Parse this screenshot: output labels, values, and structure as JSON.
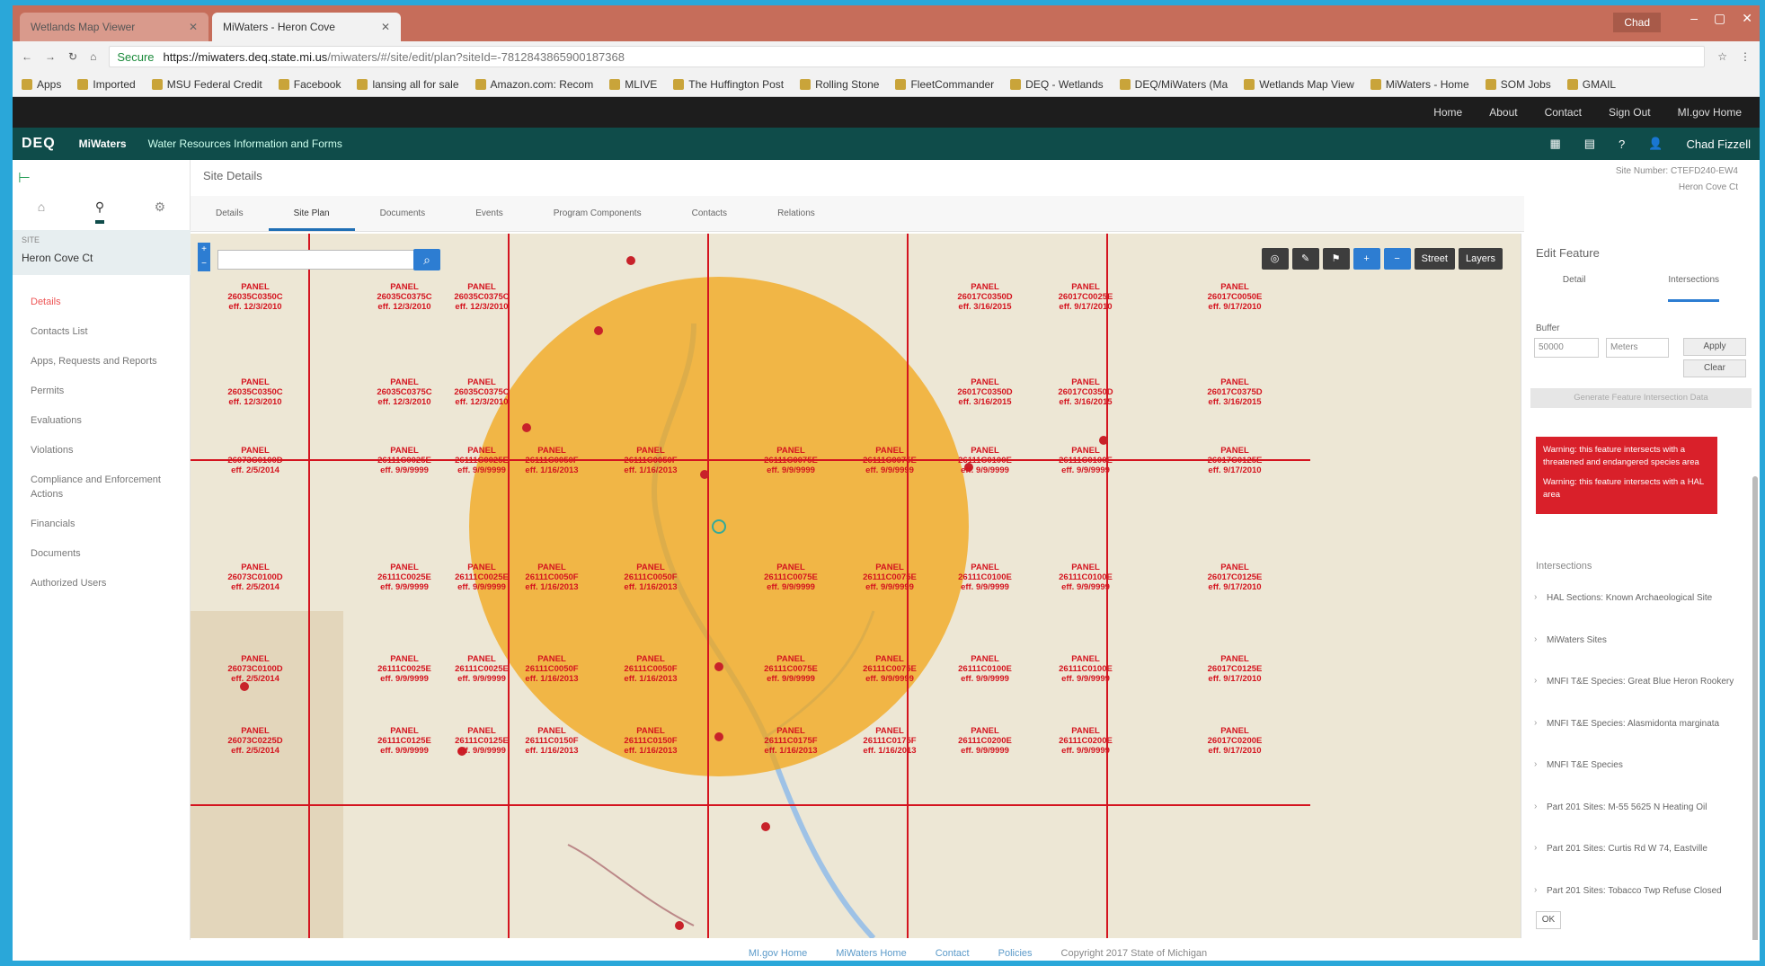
{
  "browser": {
    "tabs": [
      {
        "label": "Wetlands Map Viewer",
        "active": false
      },
      {
        "label": "MiWaters - Heron Cove",
        "active": true
      }
    ],
    "user": "Chad",
    "url": {
      "secure": "Secure",
      "host": "https://miwaters.deq.state.mi.us",
      "path": "/miwaters/#/site/edit/plan?siteId=-7812843865900187368"
    },
    "bookmarks": [
      "Apps",
      "Imported",
      "MSU Federal Credit",
      "Facebook",
      "lansing all for sale",
      "Amazon.com: Recom",
      "MLIVE",
      "The Huffington Post",
      "Rolling Stone",
      "FleetCommander",
      "DEQ - Wetlands",
      "DEQ/MiWaters (Ma",
      "Wetlands Map View",
      "MiWaters - Home",
      "SOM Jobs",
      "GMAIL"
    ]
  },
  "topnav": [
    "Home",
    "About",
    "Contact",
    "Sign Out",
    "MI.gov Home"
  ],
  "appbar": {
    "logo": "DEQ",
    "app": "MiWaters",
    "subtitle": "Water Resources Information and Forms",
    "user": "Chad Fizzell"
  },
  "left": {
    "site_label": "SITE",
    "site_name": "Heron Cove Ct",
    "menu": [
      "Details",
      "Contacts List",
      "Apps, Requests and Reports",
      "Permits",
      "Evaluations",
      "Violations",
      "Compliance and Enforcement Actions",
      "Financials",
      "Documents",
      "Authorized Users"
    ]
  },
  "content": {
    "title": "Site Details",
    "site_number_label": "Site Number: CTEFD240-EW4",
    "site_name": "Heron Cove Ct",
    "tabs": [
      "Details",
      "Site Plan",
      "Documents",
      "Events",
      "Program Components",
      "Contacts",
      "Relations"
    ]
  },
  "map": {
    "tools": [
      "Street",
      "Layers"
    ],
    "panels": [
      [
        "PANEL",
        "26035C0350C",
        "eff. 12/3/2010"
      ],
      [
        "PANEL",
        "26035C0375C",
        "eff. 12/3/2010"
      ],
      [
        "PANEL",
        "26035C0375C",
        "eff. 12/3/2010"
      ],
      [
        "PANEL",
        "26017C0350D",
        "eff. 3/16/2015"
      ],
      [
        "PANEL",
        "26017C0025E",
        "eff. 9/17/2010"
      ],
      [
        "PANEL",
        "26017C0050E",
        "eff. 9/17/2010"
      ],
      [
        "PANEL",
        "26035C0350C",
        "eff. 12/3/2010"
      ],
      [
        "PANEL",
        "26035C0375C",
        "eff. 12/3/2010"
      ],
      [
        "PANEL",
        "26035C0375C",
        "eff. 12/3/2010"
      ],
      [
        "PANEL",
        "26017C0350D",
        "eff. 3/16/2015"
      ],
      [
        "PANEL",
        "26017C0350D",
        "eff. 3/16/2015"
      ],
      [
        "PANEL",
        "26017C0375D",
        "eff. 3/16/2015"
      ],
      [
        "PANEL",
        "26073C0100D",
        "eff. 2/5/2014"
      ],
      [
        "PANEL",
        "26111C0025E",
        "eff. 9/9/9999"
      ],
      [
        "PANEL",
        "26111C0025E",
        "eff. 9/9/9999"
      ],
      [
        "PANEL",
        "26111C0050F",
        "eff. 1/16/2013"
      ],
      [
        "PANEL",
        "26111C0050F",
        "eff. 1/16/2013"
      ],
      [
        "PANEL",
        "26111C0075E",
        "eff. 9/9/9999"
      ],
      [
        "PANEL",
        "26111C0075E",
        "eff. 9/9/9999"
      ],
      [
        "PANEL",
        "26111C0100E",
        "eff. 9/9/9999"
      ],
      [
        "PANEL",
        "26111C0100E",
        "eff. 9/9/9999"
      ],
      [
        "PANEL",
        "26017C0125E",
        "eff. 9/17/2010"
      ],
      [
        "PANEL",
        "26073C0100D",
        "eff. 2/5/2014"
      ],
      [
        "PANEL",
        "26111C0025E",
        "eff. 9/9/9999"
      ],
      [
        "PANEL",
        "26111C0025E",
        "eff. 9/9/9999"
      ],
      [
        "PANEL",
        "26111C0050F",
        "eff. 1/16/2013"
      ],
      [
        "PANEL",
        "26111C0050F",
        "eff. 1/16/2013"
      ],
      [
        "PANEL",
        "26111C0075E",
        "eff. 9/9/9999"
      ],
      [
        "PANEL",
        "26111C0075E",
        "eff. 9/9/9999"
      ],
      [
        "PANEL",
        "26111C0100E",
        "eff. 9/9/9999"
      ],
      [
        "PANEL",
        "26111C0100E",
        "eff. 9/9/9999"
      ],
      [
        "PANEL",
        "26017C0125E",
        "eff. 9/17/2010"
      ],
      [
        "PANEL",
        "26073C0100D",
        "eff. 2/5/2014"
      ],
      [
        "PANEL",
        "26111C0025E",
        "eff. 9/9/9999"
      ],
      [
        "PANEL",
        "26111C0025E",
        "eff. 9/9/9999"
      ],
      [
        "PANEL",
        "26111C0050F",
        "eff. 1/16/2013"
      ],
      [
        "PANEL",
        "26111C0050F",
        "eff. 1/16/2013"
      ],
      [
        "PANEL",
        "26111C0075E",
        "eff. 9/9/9999"
      ],
      [
        "PANEL",
        "26111C0075E",
        "eff. 9/9/9999"
      ],
      [
        "PANEL",
        "26111C0100E",
        "eff. 9/9/9999"
      ],
      [
        "PANEL",
        "26111C0100E",
        "eff. 9/9/9999"
      ],
      [
        "PANEL",
        "26017C0125E",
        "eff. 9/17/2010"
      ],
      [
        "PANEL",
        "26073C0225D",
        "eff. 2/5/2014"
      ],
      [
        "PANEL",
        "26111C0125E",
        "eff. 9/9/9999"
      ],
      [
        "PANEL",
        "26111C0125E",
        "eff. 9/9/9999"
      ],
      [
        "PANEL",
        "26111C0150F",
        "eff. 1/16/2013"
      ],
      [
        "PANEL",
        "26111C0150F",
        "eff. 1/16/2013"
      ],
      [
        "PANEL",
        "26111C0175F",
        "eff. 1/16/2013"
      ],
      [
        "PANEL",
        "26111C0175F",
        "eff. 1/16/2013"
      ],
      [
        "PANEL",
        "26111C0200E",
        "eff. 9/9/9999"
      ],
      [
        "PANEL",
        "26111C0200E",
        "eff. 9/9/9999"
      ],
      [
        "PANEL",
        "26017C0200E",
        "eff. 9/17/2010"
      ]
    ]
  },
  "edit_feature": {
    "title": "Edit Feature",
    "tabs": [
      "Detail",
      "Intersections"
    ],
    "buffer_label": "Buffer",
    "buffer_value": "50000",
    "unit": "Meters",
    "apply": "Apply",
    "clear": "Clear",
    "generate": "Generate Feature Intersection Data",
    "warnings": [
      "Warning: this feature intersects with a threatened and endangered species area",
      "Warning: this feature intersects with a HAL area"
    ],
    "intersections_label": "Intersections",
    "intersections": [
      "HAL Sections: Known Archaeological Site",
      "MiWaters Sites",
      "MNFI T&E Species: Great Blue Heron Rookery",
      "MNFI T&E Species: Alasmidonta marginata",
      "MNFI T&E Species",
      "Part 201 Sites: M-55 5625 N Heating Oil",
      "Part 201 Sites: Curtis Rd W 74, Eastville",
      "Part 201 Sites: Tobacco Twp Refuse Closed"
    ],
    "ok": "OK"
  },
  "footer": [
    "MI.gov Home",
    "MiWaters Home",
    "Contact",
    "Policies",
    "Copyright 2017 State of Michigan"
  ],
  "colors": {
    "app_bar": "#0f4c4a",
    "buffer_circle": "#f2a516",
    "panel_lines": "#d4141f",
    "warning": "#d9202a"
  }
}
